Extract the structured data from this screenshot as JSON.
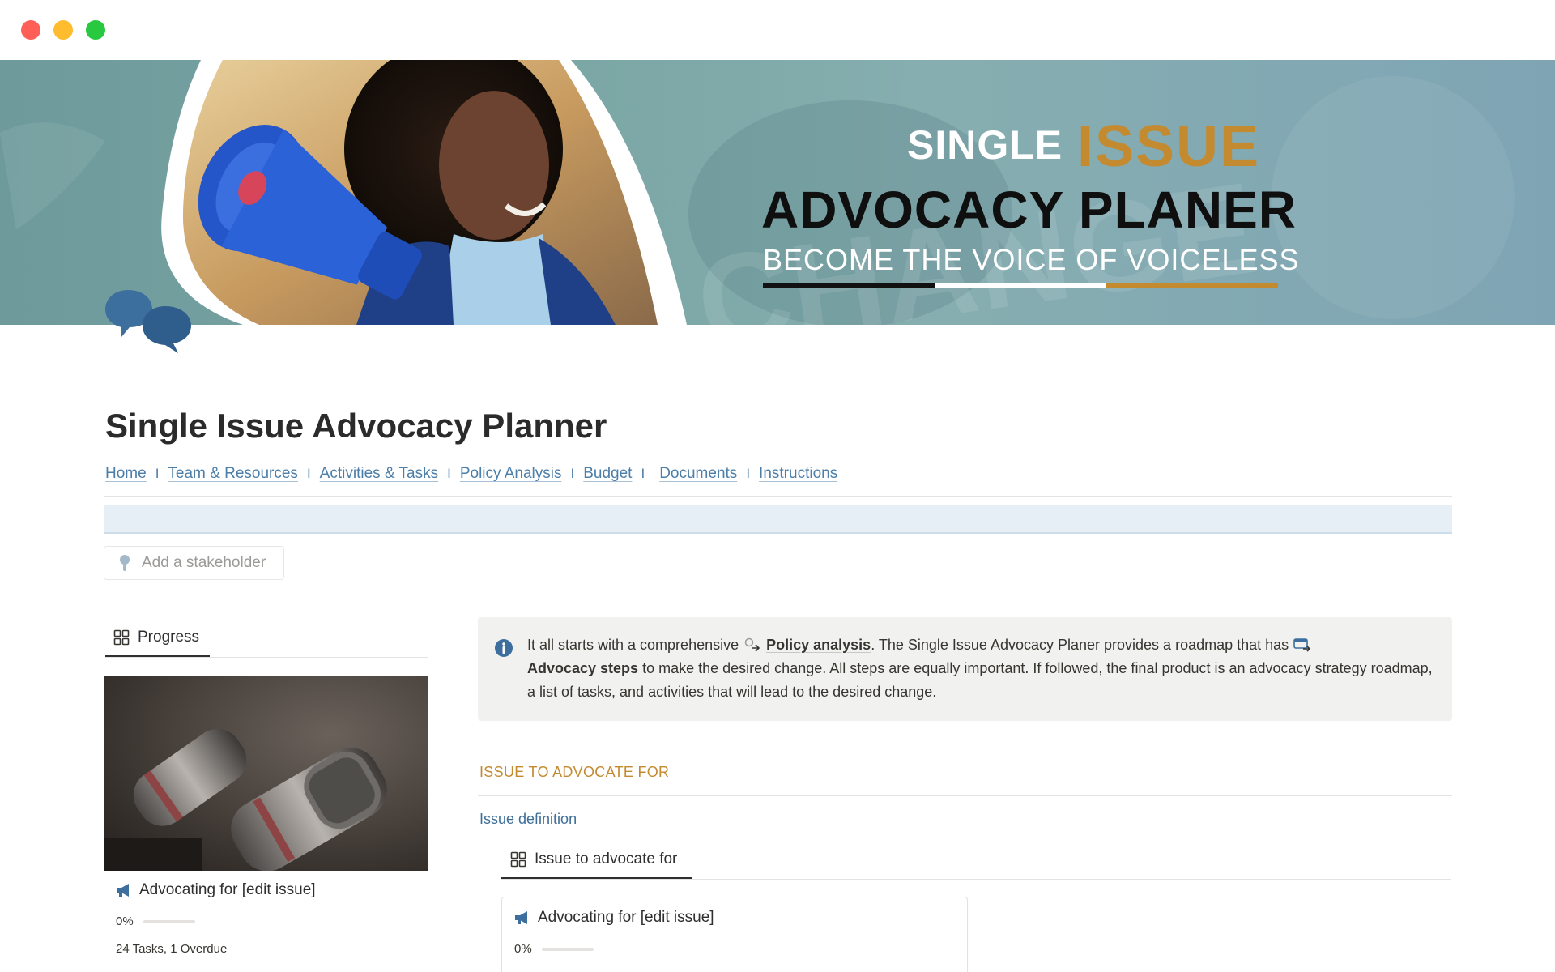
{
  "window": {
    "controls": [
      "close",
      "minimize",
      "maximize"
    ]
  },
  "banner": {
    "title_line_1a": "SINGLE",
    "title_line_1b": "ISSUE",
    "title_line_2": "ADVOCACY PLANER",
    "tagline": "BECOME THE VOICE OF VOICELESS",
    "accent_color": "#c48a30"
  },
  "page": {
    "icon": "speech-bubbles-icon",
    "title": "Single Issue Advocacy Planner"
  },
  "nav": {
    "items": [
      {
        "label": "Home"
      },
      {
        "label": "Team & Resources"
      },
      {
        "label": "Activities & Tasks"
      },
      {
        "label": "Policy Analysis"
      },
      {
        "label": "Budget"
      },
      {
        "label": "Documents"
      },
      {
        "label": "Instructions"
      }
    ],
    "separator": "I"
  },
  "stakeholder": {
    "button_label": "Add a stakeholder"
  },
  "progress_view": {
    "tab_label": "Progress",
    "card": {
      "title": "Advocating for [edit issue]",
      "percent": "0%",
      "progress_value": 0,
      "meta": "24 Tasks, 1 Overdue"
    }
  },
  "callout": {
    "prefix": "It all starts with a comprehensive",
    "link1": "Policy analysis",
    "middle": ". The Single Issue Advocacy Planer provides a roadmap that has",
    "link2": "Advocacy steps",
    "suffix": "to make the desired change. All steps are equally important. If followed, the final product is an advocacy strategy roadmap, a list of tasks, and activities that will lead to the desired change."
  },
  "issue_section": {
    "heading": "ISSUE TO ADVOCATE FOR",
    "subheading": "Issue definition",
    "tab_label": "Issue to advocate for",
    "card": {
      "title": "Advocating for [edit issue]",
      "percent": "0%",
      "progress_value": 0
    }
  },
  "colors": {
    "link_blue": "#4b7ea8",
    "heading_gold": "#c48a30",
    "callout_bg": "#f1f1ef"
  }
}
